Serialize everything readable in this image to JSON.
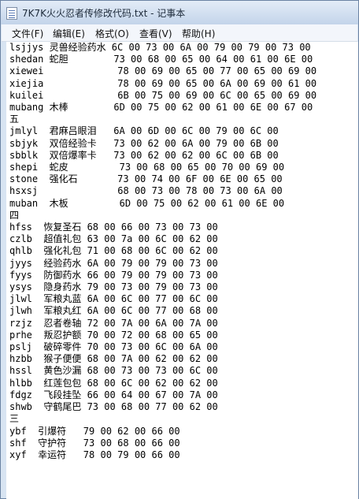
{
  "window": {
    "title": "7K7K火火忍者传修改代码.txt - 记事本",
    "icon": "notepad-icon"
  },
  "menu": [
    {
      "label": "文件(F)"
    },
    {
      "label": "编辑(E)"
    },
    {
      "label": "格式(O)"
    },
    {
      "label": "查看(V)"
    },
    {
      "label": "帮助(H)"
    }
  ],
  "document": {
    "lines": [
      "lsjjys 灵兽经验药水 6C 00 73 00 6A 00 79 00 79 00 73 00",
      "shedan 蛇胆        73 00 68 00 65 00 64 00 61 00 6E 00",
      "xiewei             78 00 69 00 65 00 77 00 65 00 69 00",
      "xiejia             78 00 69 00 65 00 6A 00 69 00 61 00",
      "kuilei             6B 00 75 00 69 00 6C 00 65 00 69 00",
      "mubang 木棒        6D 00 75 00 62 00 61 00 6E 00 67 00",
      "五",
      "jmlyl  君麻吕眼泪   6A 00 6D 00 6C 00 79 00 6C 00",
      "sbjyk  双倍经验卡   73 00 62 00 6A 00 79 00 6B 00",
      "sbblk  双倍爆率卡   73 00 62 00 62 00 6C 00 6B 00",
      "shepi  蛇皮         73 00 68 00 65 00 70 00 69 00",
      "stone  强化石       73 00 74 00 6F 00 6E 00 65 00",
      "hsxsj              68 00 73 00 78 00 73 00 6A 00",
      "muban  木板         6D 00 75 00 62 00 61 00 6E 00",
      "四",
      "hfss  恢复圣石 68 00 66 00 73 00 73 00",
      "czlb  超值礼包 63 00 7a 00 6C 00 62 00",
      "qhlb  强化礼包 71 00 68 00 6C 00 62 00",
      "jyys  经验药水 6A 00 79 00 79 00 73 00",
      "fyys  防御药水 66 00 79 00 79 00 73 00",
      "ysys  隐身药水 79 00 73 00 79 00 73 00",
      "jlwl  军粮丸蓝 6A 00 6C 00 77 00 6C 00",
      "jlwh  军粮丸红 6A 00 6C 00 77 00 68 00",
      "rzjz  忍者卷轴 72 00 7A 00 6A 00 7A 00",
      "prhe  叛忍护额 70 00 72 00 68 00 65 00",
      "pslj  破碎零件 70 00 73 00 6C 00 6A 00",
      "hzbb  猴子便便 68 00 7A 00 62 00 62 00",
      "hssl  黄色沙漏 68 00 73 00 73 00 6C 00",
      "hlbb  红莲包包 68 00 6C 00 62 00 62 00",
      "fdgz  飞段挂坠 66 00 64 00 67 00 7A 00",
      "shwb  守鹤尾巴 73 00 68 00 77 00 62 00",
      "三",
      "ybf  引爆符   79 00 62 00 66 00",
      "shf  守护符   73 00 68 00 66 00",
      "xyf  幸运符   78 00 79 00 66 00"
    ]
  }
}
